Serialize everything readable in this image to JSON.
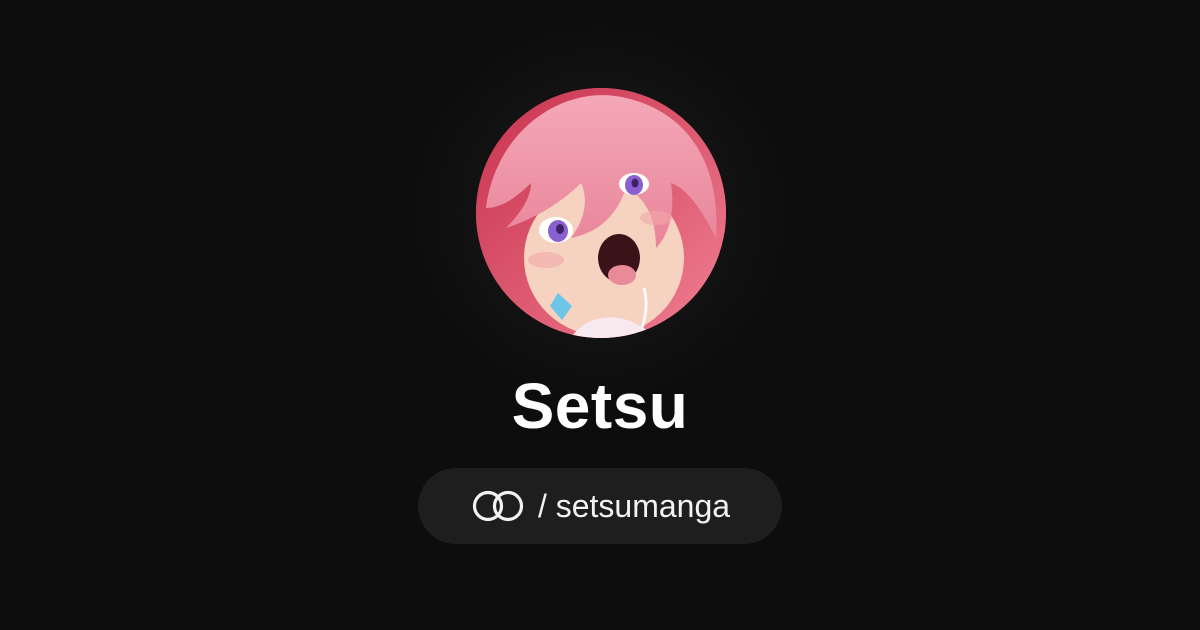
{
  "profile": {
    "display_name": "Setsu",
    "handle": "/ setsumanga",
    "avatar_icon": "avatar-image",
    "brand_icon": "linked-rings-icon"
  },
  "colors": {
    "background": "#0d0d0d",
    "pill_background": "#1e1e1e",
    "text": "#ffffff",
    "avatar_accent": "#d84a62"
  }
}
